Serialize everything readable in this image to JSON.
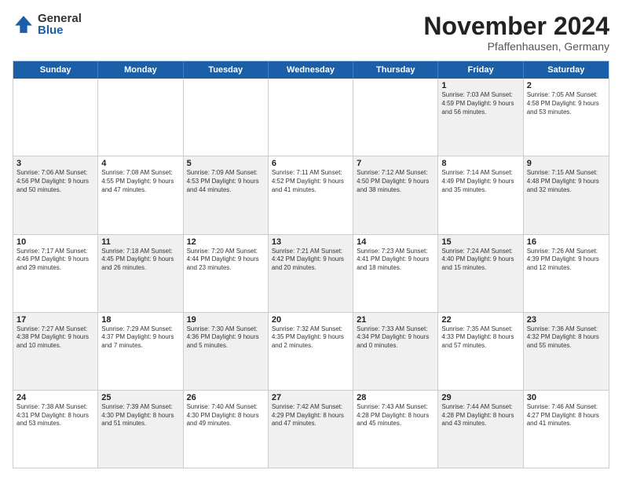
{
  "logo": {
    "general": "General",
    "blue": "Blue"
  },
  "title": "November 2024",
  "subtitle": "Pfaffenhausen, Germany",
  "header_days": [
    "Sunday",
    "Monday",
    "Tuesday",
    "Wednesday",
    "Thursday",
    "Friday",
    "Saturday"
  ],
  "rows": [
    [
      {
        "day": "",
        "info": "",
        "shaded": false,
        "empty": true
      },
      {
        "day": "",
        "info": "",
        "shaded": false,
        "empty": true
      },
      {
        "day": "",
        "info": "",
        "shaded": false,
        "empty": true
      },
      {
        "day": "",
        "info": "",
        "shaded": false,
        "empty": true
      },
      {
        "day": "",
        "info": "",
        "shaded": false,
        "empty": true
      },
      {
        "day": "1",
        "info": "Sunrise: 7:03 AM\nSunset: 4:59 PM\nDaylight: 9 hours\nand 56 minutes.",
        "shaded": true
      },
      {
        "day": "2",
        "info": "Sunrise: 7:05 AM\nSunset: 4:58 PM\nDaylight: 9 hours\nand 53 minutes.",
        "shaded": false
      }
    ],
    [
      {
        "day": "3",
        "info": "Sunrise: 7:06 AM\nSunset: 4:56 PM\nDaylight: 9 hours\nand 50 minutes.",
        "shaded": true
      },
      {
        "day": "4",
        "info": "Sunrise: 7:08 AM\nSunset: 4:55 PM\nDaylight: 9 hours\nand 47 minutes.",
        "shaded": false
      },
      {
        "day": "5",
        "info": "Sunrise: 7:09 AM\nSunset: 4:53 PM\nDaylight: 9 hours\nand 44 minutes.",
        "shaded": true
      },
      {
        "day": "6",
        "info": "Sunrise: 7:11 AM\nSunset: 4:52 PM\nDaylight: 9 hours\nand 41 minutes.",
        "shaded": false
      },
      {
        "day": "7",
        "info": "Sunrise: 7:12 AM\nSunset: 4:50 PM\nDaylight: 9 hours\nand 38 minutes.",
        "shaded": true
      },
      {
        "day": "8",
        "info": "Sunrise: 7:14 AM\nSunset: 4:49 PM\nDaylight: 9 hours\nand 35 minutes.",
        "shaded": false
      },
      {
        "day": "9",
        "info": "Sunrise: 7:15 AM\nSunset: 4:48 PM\nDaylight: 9 hours\nand 32 minutes.",
        "shaded": true
      }
    ],
    [
      {
        "day": "10",
        "info": "Sunrise: 7:17 AM\nSunset: 4:46 PM\nDaylight: 9 hours\nand 29 minutes.",
        "shaded": false
      },
      {
        "day": "11",
        "info": "Sunrise: 7:18 AM\nSunset: 4:45 PM\nDaylight: 9 hours\nand 26 minutes.",
        "shaded": true
      },
      {
        "day": "12",
        "info": "Sunrise: 7:20 AM\nSunset: 4:44 PM\nDaylight: 9 hours\nand 23 minutes.",
        "shaded": false
      },
      {
        "day": "13",
        "info": "Sunrise: 7:21 AM\nSunset: 4:42 PM\nDaylight: 9 hours\nand 20 minutes.",
        "shaded": true
      },
      {
        "day": "14",
        "info": "Sunrise: 7:23 AM\nSunset: 4:41 PM\nDaylight: 9 hours\nand 18 minutes.",
        "shaded": false
      },
      {
        "day": "15",
        "info": "Sunrise: 7:24 AM\nSunset: 4:40 PM\nDaylight: 9 hours\nand 15 minutes.",
        "shaded": true
      },
      {
        "day": "16",
        "info": "Sunrise: 7:26 AM\nSunset: 4:39 PM\nDaylight: 9 hours\nand 12 minutes.",
        "shaded": false
      }
    ],
    [
      {
        "day": "17",
        "info": "Sunrise: 7:27 AM\nSunset: 4:38 PM\nDaylight: 9 hours\nand 10 minutes.",
        "shaded": true
      },
      {
        "day": "18",
        "info": "Sunrise: 7:29 AM\nSunset: 4:37 PM\nDaylight: 9 hours\nand 7 minutes.",
        "shaded": false
      },
      {
        "day": "19",
        "info": "Sunrise: 7:30 AM\nSunset: 4:36 PM\nDaylight: 9 hours\nand 5 minutes.",
        "shaded": true
      },
      {
        "day": "20",
        "info": "Sunrise: 7:32 AM\nSunset: 4:35 PM\nDaylight: 9 hours\nand 2 minutes.",
        "shaded": false
      },
      {
        "day": "21",
        "info": "Sunrise: 7:33 AM\nSunset: 4:34 PM\nDaylight: 9 hours\nand 0 minutes.",
        "shaded": true
      },
      {
        "day": "22",
        "info": "Sunrise: 7:35 AM\nSunset: 4:33 PM\nDaylight: 8 hours\nand 57 minutes.",
        "shaded": false
      },
      {
        "day": "23",
        "info": "Sunrise: 7:36 AM\nSunset: 4:32 PM\nDaylight: 8 hours\nand 55 minutes.",
        "shaded": true
      }
    ],
    [
      {
        "day": "24",
        "info": "Sunrise: 7:38 AM\nSunset: 4:31 PM\nDaylight: 8 hours\nand 53 minutes.",
        "shaded": false
      },
      {
        "day": "25",
        "info": "Sunrise: 7:39 AM\nSunset: 4:30 PM\nDaylight: 8 hours\nand 51 minutes.",
        "shaded": true
      },
      {
        "day": "26",
        "info": "Sunrise: 7:40 AM\nSunset: 4:30 PM\nDaylight: 8 hours\nand 49 minutes.",
        "shaded": false
      },
      {
        "day": "27",
        "info": "Sunrise: 7:42 AM\nSunset: 4:29 PM\nDaylight: 8 hours\nand 47 minutes.",
        "shaded": true
      },
      {
        "day": "28",
        "info": "Sunrise: 7:43 AM\nSunset: 4:28 PM\nDaylight: 8 hours\nand 45 minutes.",
        "shaded": false
      },
      {
        "day": "29",
        "info": "Sunrise: 7:44 AM\nSunset: 4:28 PM\nDaylight: 8 hours\nand 43 minutes.",
        "shaded": true
      },
      {
        "day": "30",
        "info": "Sunrise: 7:46 AM\nSunset: 4:27 PM\nDaylight: 8 hours\nand 41 minutes.",
        "shaded": false
      }
    ]
  ]
}
